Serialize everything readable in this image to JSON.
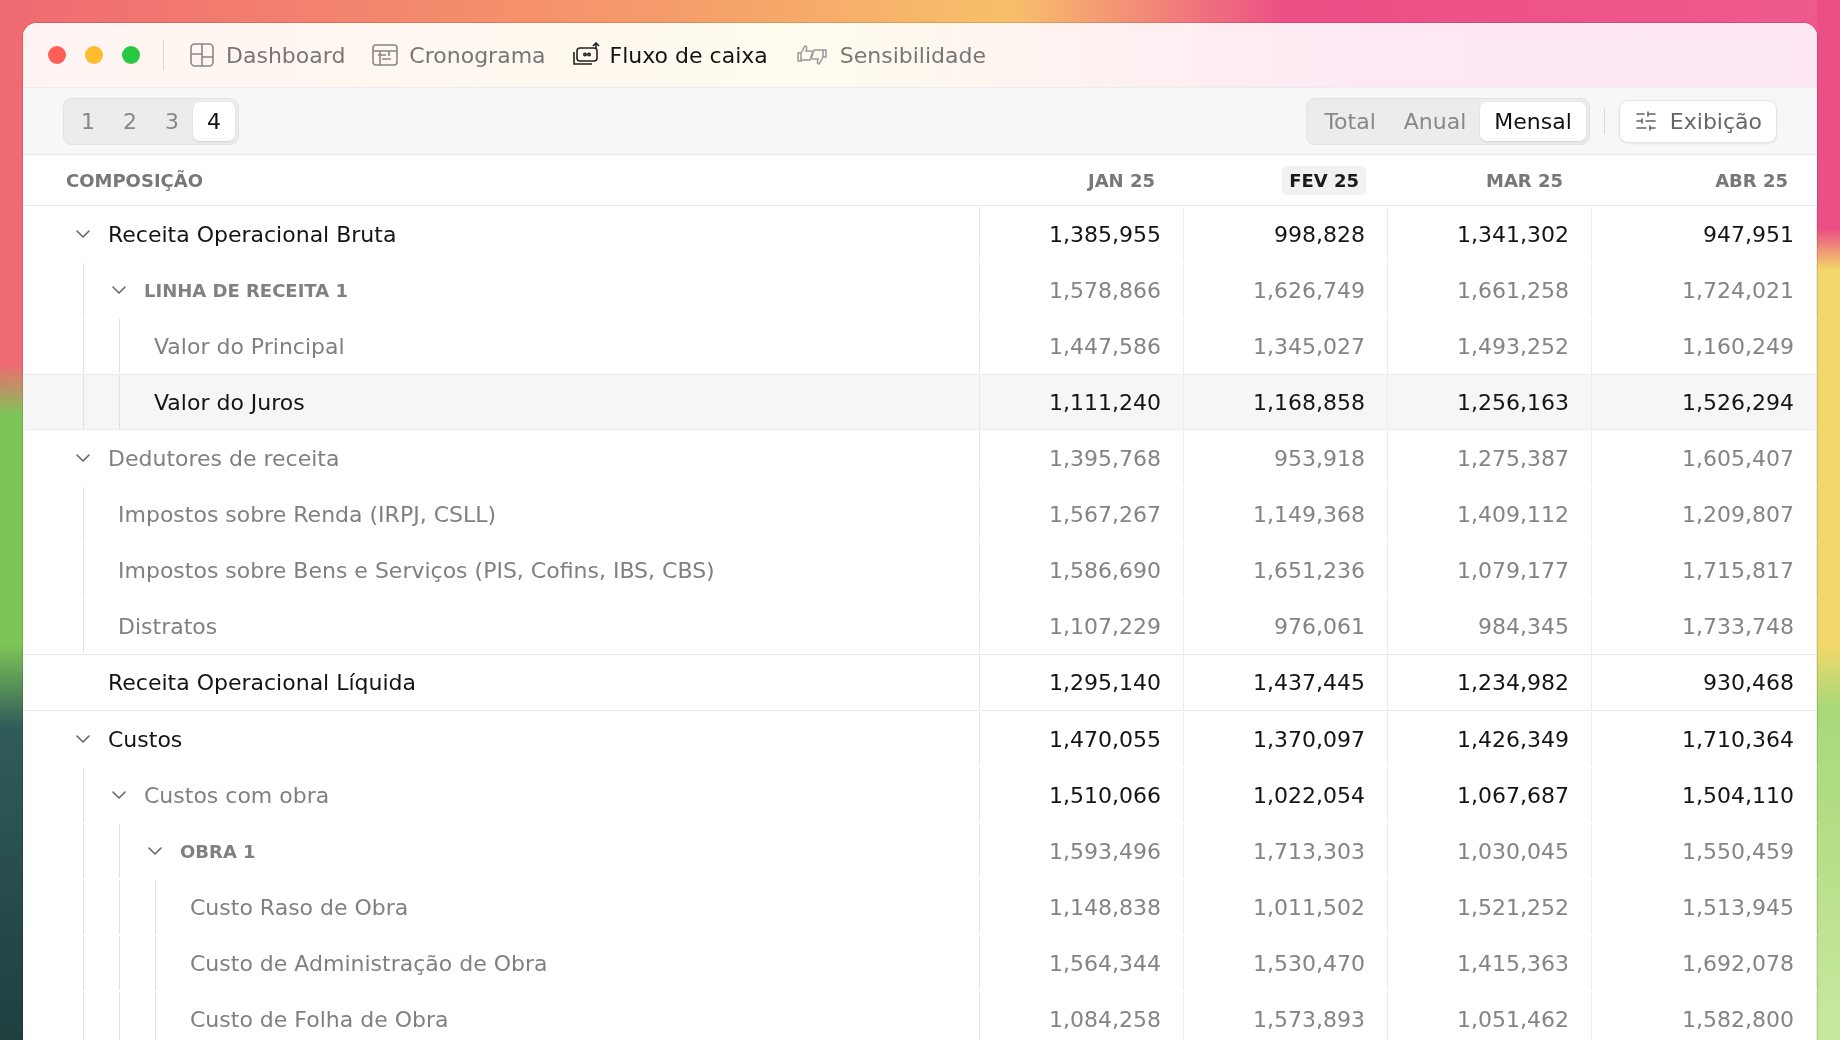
{
  "window": {
    "controls": [
      {
        "color": "#fe5f57"
      },
      {
        "color": "#febc2e"
      },
      {
        "color": "#28c840"
      }
    ],
    "tabs": [
      {
        "label": "Dashboard",
        "kind": "grid",
        "selected": false
      },
      {
        "label": "Cronograma",
        "kind": "timeline",
        "selected": false
      },
      {
        "label": "Fluxo de caixa",
        "kind": "cash",
        "selected": true
      },
      {
        "label": "Sensibilidade",
        "kind": "thumbs",
        "selected": false
      }
    ]
  },
  "pages": [
    {
      "label": "1",
      "selected": false
    },
    {
      "label": "2",
      "selected": false
    },
    {
      "label": "3",
      "selected": false
    },
    {
      "label": "4",
      "selected": true
    }
  ],
  "period": [
    {
      "label": "Total",
      "selected": false
    },
    {
      "label": "Anual",
      "selected": false
    },
    {
      "label": "Mensal",
      "selected": true
    }
  ],
  "display_button": "Exibição",
  "table": {
    "columns": [
      {
        "label": "COMPOSIÇÃO",
        "selected": false
      },
      {
        "label": "JAN 25",
        "selected": false
      },
      {
        "label": "FEV 25",
        "selected": true
      },
      {
        "label": "MAR 25",
        "selected": false
      },
      {
        "label": "ABR 25",
        "selected": false
      }
    ],
    "rows": [
      {
        "label": "Receita Operacional Bruta",
        "kind": "group",
        "expanded": true,
        "hovered": false,
        "values": [
          "1,385,955",
          "998,828",
          "1,341,302",
          "947,951"
        ],
        "children": [
          {
            "label": "LINHA DE RECEITA 1",
            "kind": "section",
            "expanded": true,
            "hovered": false,
            "values": [
              "1,578,866",
              "1,626,749",
              "1,661,258",
              "1,724,021"
            ],
            "children": [
              {
                "label": "Valor do Principal",
                "kind": "item",
                "hovered": false,
                "values": [
                  "1,447,586",
                  "1,345,027",
                  "1,493,252",
                  "1,160,249"
                ]
              },
              {
                "label": "Valor do Juros",
                "kind": "item",
                "hovered": true,
                "values": [
                  "1,111,240",
                  "1,168,858",
                  "1,256,163",
                  "1,526,294"
                ]
              }
            ]
          }
        ]
      },
      {
        "label": "Dedutores de receita",
        "kind": "item",
        "expanded": true,
        "hovered": false,
        "values": [
          "1,395,768",
          "953,918",
          "1,275,387",
          "1,605,407"
        ],
        "children": [
          {
            "label": "Impostos sobre Renda (IRPJ, CSLL)",
            "kind": "item",
            "hovered": false,
            "values": [
              "1,567,267",
              "1,149,368",
              "1,409,112",
              "1,209,807"
            ]
          },
          {
            "label": "Impostos sobre Bens e Serviços (PIS, Cofins, IBS, CBS)",
            "kind": "item",
            "hovered": false,
            "values": [
              "1,586,690",
              "1,651,236",
              "1,079,177",
              "1,715,817"
            ]
          },
          {
            "label": "Distratos",
            "kind": "item",
            "hovered": false,
            "values": [
              "1,107,229",
              "976,061",
              "984,345",
              "1,733,748"
            ]
          }
        ]
      },
      {
        "label": "Receita Operacional Líquida",
        "kind": "total",
        "hovered": false,
        "values": [
          "1,295,140",
          "1,437,445",
          "1,234,982",
          "930,468"
        ]
      },
      {
        "label": "Custos",
        "kind": "group",
        "expanded": true,
        "hovered": false,
        "values": [
          "1,470,055",
          "1,370,097",
          "1,426,349",
          "1,710,364"
        ],
        "children": [
          {
            "label": "Custos com obra",
            "kind": "subgroup",
            "expanded": true,
            "hovered": false,
            "values": [
              "1,510,066",
              "1,022,054",
              "1,067,687",
              "1,504,110"
            ],
            "children": [
              {
                "label": "OBRA 1",
                "kind": "section",
                "expanded": true,
                "hovered": false,
                "values": [
                  "1,593,496",
                  "1,713,303",
                  "1,030,045",
                  "1,550,459"
                ],
                "children": [
                  {
                    "label": "Custo Raso de Obra",
                    "kind": "item",
                    "hovered": false,
                    "values": [
                      "1,148,838",
                      "1,011,502",
                      "1,521,252",
                      "1,513,945"
                    ]
                  },
                  {
                    "label": "Custo de Administração de Obra",
                    "kind": "item",
                    "hovered": false,
                    "values": [
                      "1,564,344",
                      "1,530,470",
                      "1,415,363",
                      "1,692,078"
                    ]
                  },
                  {
                    "label": "Custo de Folha de Obra",
                    "kind": "item",
                    "hovered": false,
                    "values": [
                      "1,084,258",
                      "1,573,893",
                      "1,051,462",
                      "1,582,800"
                    ]
                  }
                ]
              }
            ]
          }
        ]
      }
    ]
  }
}
